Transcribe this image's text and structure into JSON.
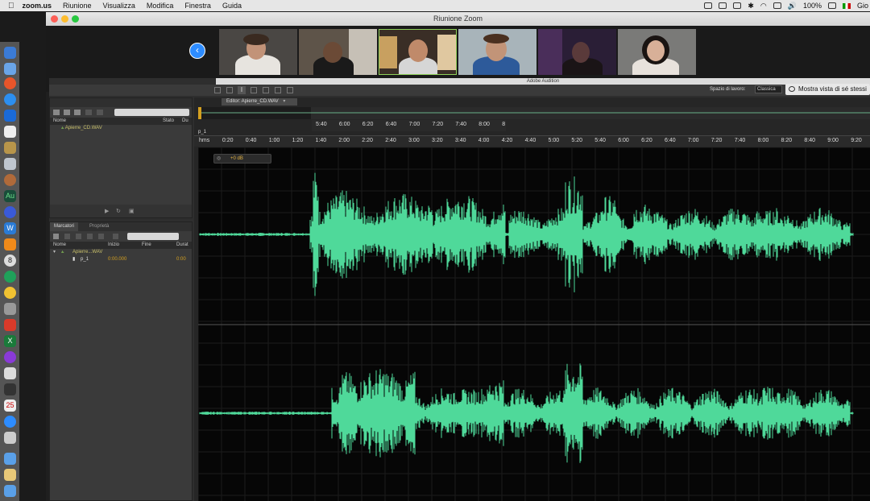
{
  "menubar": {
    "app_name": "zoom.us",
    "items": [
      "Riunione",
      "Visualizza",
      "Modifica",
      "Finestra",
      "Guida"
    ],
    "battery": "100%",
    "user": "Gio"
  },
  "zoom": {
    "title": "Riunione Zoom",
    "self_view_label": "Mostra vista di sé stessi"
  },
  "audition": {
    "title": "Adobe Audition",
    "workspace_label": "Spazio di lavoro:",
    "workspace_value": "Classica",
    "files_panel": {
      "col_name": "Nome",
      "col_status": "Stato",
      "col_du": "Du",
      "file": "Apierre_CD.WAV"
    },
    "markers_panel": {
      "tab_markers": "Marcatori",
      "tab_properties": "Proprietà",
      "col_name": "Nome",
      "col_start": "Inizio",
      "col_end": "Fine",
      "col_duration": "Durat",
      "group_name": "Apierre...WAV",
      "marker_name": "p_1",
      "marker_start": "0:00.000",
      "marker_dur": "0:00"
    },
    "editor": {
      "tab_label": "Editor: Apierre_CD.WAV",
      "marker_label": "p_1",
      "hud_gain": "+0 dB",
      "ruler_ticks": [
        "hms",
        "0:20",
        "0:40",
        "1:00",
        "1:20",
        "1:40",
        "2:00",
        "2:20",
        "2:40",
        "3:00",
        "3:20",
        "3:40",
        "4:00",
        "4:20",
        "4:40",
        "5:00",
        "5:20",
        "5:40",
        "6:00",
        "6:20",
        "6:40",
        "7:00",
        "7:20",
        "7:40",
        "8:00",
        "8:20",
        "8:40",
        "9:00",
        "9:20"
      ],
      "ruler_ticks_overlay": [
        "5:40",
        "6:00",
        "6:20",
        "6:40",
        "7:00",
        "7:20",
        "7:40",
        "8:00",
        "8"
      ]
    }
  }
}
